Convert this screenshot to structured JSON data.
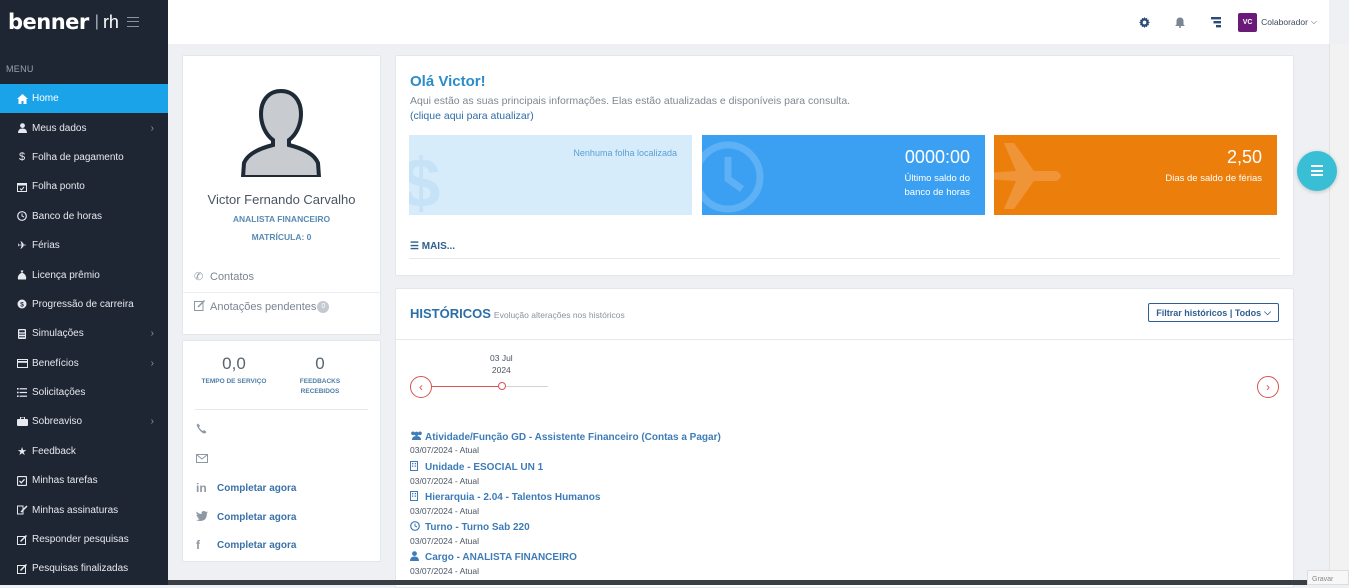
{
  "sidebar": {
    "logo_word": "benner",
    "logo_sep": "|",
    "logo_rh": "rh",
    "menu_label": "MENU",
    "items": [
      {
        "label": "Home",
        "icon": "home-icon",
        "active": true,
        "submenu": false
      },
      {
        "label": "Meus dados",
        "icon": "user-icon",
        "submenu": true
      },
      {
        "label": "Folha de pagamento",
        "icon": "dollar-icon",
        "submenu": false
      },
      {
        "label": "Folha ponto",
        "icon": "calendar-check-icon",
        "submenu": false
      },
      {
        "label": "Banco de horas",
        "icon": "clock-icon",
        "submenu": false
      },
      {
        "label": "Férias",
        "icon": "plane-icon",
        "submenu": false
      },
      {
        "label": "Licença prêmio",
        "icon": "money-bag-icon",
        "submenu": false
      },
      {
        "label": "Progressão de carreira",
        "icon": "coin-icon",
        "submenu": false
      },
      {
        "label": "Simulações",
        "icon": "calculator-icon",
        "submenu": true
      },
      {
        "label": "Benefícios",
        "icon": "card-icon",
        "submenu": true
      },
      {
        "label": "Solicitações",
        "icon": "list-icon",
        "submenu": false
      },
      {
        "label": "Sobreaviso",
        "icon": "briefcase-icon",
        "submenu": true
      },
      {
        "label": "Feedback",
        "icon": "star-icon",
        "submenu": false
      },
      {
        "label": "Minhas tarefas",
        "icon": "checkbox-icon",
        "submenu": false
      },
      {
        "label": "Minhas assinaturas",
        "icon": "signature-icon",
        "submenu": false
      },
      {
        "label": "Responder pesquisas",
        "icon": "edit-icon",
        "submenu": false
      },
      {
        "label": "Pesquisas finalizadas",
        "icon": "edit-done-icon",
        "submenu": false
      }
    ]
  },
  "topbar": {
    "user_initials": "VC",
    "user_role": "Colaborador",
    "user_color": "#6a1b7a"
  },
  "profile": {
    "name": "Victor Fernando Carvalho",
    "role": "ANALISTA FINANCEIRO",
    "matricula": "MATRÍCULA: 0",
    "contacts_label": "Contatos",
    "notes_label": "Anotações pendentes",
    "notes_count": "0"
  },
  "stats": {
    "tempo_value": "0,0",
    "tempo_label_1": "TEMPO DE SERVIÇO",
    "feedbacks_value": "0",
    "feedbacks_label_1": "FEEDBACKS",
    "feedbacks_label_2": "RECEBIDOS",
    "complete_label": "Completar agora"
  },
  "welcome": {
    "title": "Olá Victor!",
    "subtitle": "Aqui estão as suas principais informações. Elas estão atualizadas e disponíveis para consulta.",
    "refresh_link": "(clique aqui para atualizar)",
    "tile1_msg": "Nenhuma folha localizada",
    "tile2_value": "0000:00",
    "tile2_label_1": "Último saldo do",
    "tile2_label_2": "banco de horas",
    "tile3_value": "2,50",
    "tile3_label": "Dias de saldo de férias",
    "more_label": "MAIS...",
    "tile_colors": {
      "payslip": "#d7ecfb",
      "hours": "#3ba0f2",
      "vacation": "#ec7e0c"
    }
  },
  "history": {
    "title": "HISTÓRICOS",
    "subtitle": "Evolução alterações nos históricos",
    "filter_label": "Filtrar históricos | Todos",
    "timeline_day": "03 Jul",
    "timeline_year": "2024",
    "items": [
      {
        "icon": "users-icon",
        "title": "Atividade/Função GD - Assistente Financeiro (Contas a Pagar)",
        "date": "03/07/2024 - Atual"
      },
      {
        "icon": "building-icon",
        "title": "Unidade - ESOCIAL UN 1",
        "date": "03/07/2024 - Atual"
      },
      {
        "icon": "building-icon",
        "title": "Hierarquia - 2.04 - Talentos Humanos",
        "date": "03/07/2024 - Atual"
      },
      {
        "icon": "clock-icon",
        "title": "Turno - Turno Sab 220",
        "date": "03/07/2024 - Atual"
      },
      {
        "icon": "user-icon",
        "title": "Cargo - ANALISTA FINANCEIRO",
        "date": "03/07/2024 - Atual"
      }
    ]
  },
  "corner_badge": "Gravar"
}
